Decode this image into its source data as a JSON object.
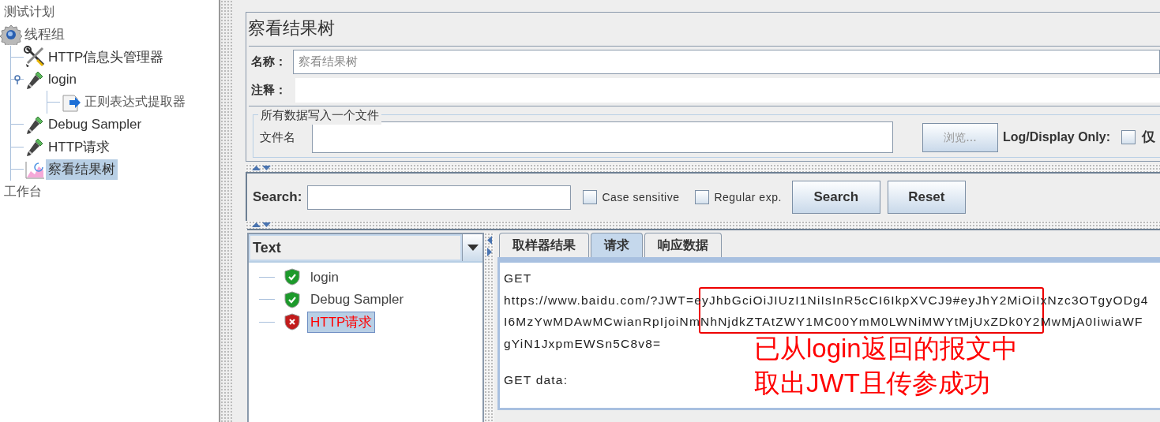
{
  "tree": [
    {
      "label": "测试计划",
      "kind": "plan",
      "selected": false,
      "children": [
        {
          "label": "线程组",
          "kind": "thread-group",
          "selected": false,
          "children": [
            {
              "label": "HTTP信息头管理器",
              "kind": "config",
              "selected": false
            },
            {
              "label": "login",
              "kind": "sampler",
              "selected": false,
              "expanded": true,
              "children": [
                {
                  "label": "正则表达式提取器",
                  "kind": "extractor",
                  "selected": false
                }
              ]
            },
            {
              "label": "Debug Sampler",
              "kind": "sampler",
              "selected": false
            },
            {
              "label": "HTTP请求",
              "kind": "sampler",
              "selected": false
            },
            {
              "label": "察看结果树",
              "kind": "listener",
              "selected": true
            }
          ]
        }
      ]
    },
    {
      "label": "工作台",
      "kind": "plan",
      "selected": false
    }
  ],
  "title": "察看结果树",
  "name_field": {
    "label": "名称：",
    "value": "察看结果树"
  },
  "comment_field": {
    "label": "注释："
  },
  "file_group": {
    "legend": "所有数据写入一个文件",
    "file_label": "文件名",
    "browse_button": {
      "label": "浏览...",
      "disabled": true
    },
    "log_label": "Log/Display Only:",
    "checkboxes": [
      {
        "label": "仅",
        "checked": false
      }
    ]
  },
  "search": {
    "label": "Search:",
    "options": [
      {
        "label": "Case sensitive",
        "checked": false
      },
      {
        "label": "Regular exp.",
        "checked": false
      }
    ],
    "buttons": [
      "Search",
      "Reset"
    ]
  },
  "renderer": {
    "value": "Text"
  },
  "results": [
    {
      "label": "login",
      "success": true,
      "selected": false
    },
    {
      "label": "Debug Sampler",
      "success": true,
      "selected": false
    },
    {
      "label": "HTTP请求",
      "success": false,
      "selected": true
    }
  ],
  "tabs": [
    {
      "label": "取样器结果",
      "selected": false
    },
    {
      "label": "请求",
      "selected": true
    },
    {
      "label": "响应数据",
      "selected": false
    }
  ],
  "request_blocks": [
    [
      "GET",
      "https://www.baidu.com/?JWT=eyJhbGciOiJIUzI1NiIsInR5cCI6IkpXVCJ9#eyJhY2MiOiIxNzc3OTgyODg4",
      "I6MzYwMDAwMCwianRpIjoiNmNhNjdkZTAtZWY1MC00YmM0LWNiMWYtMjUxZDk0Y2MwMjA0IiwiaWF",
      "gYiN1JxpmEWSn5C8v8="
    ],
    [
      "GET data:"
    ]
  ],
  "annotation": {
    "lines": [
      "已从login返回的报文中",
      "取出JWT且传参成功"
    ]
  }
}
